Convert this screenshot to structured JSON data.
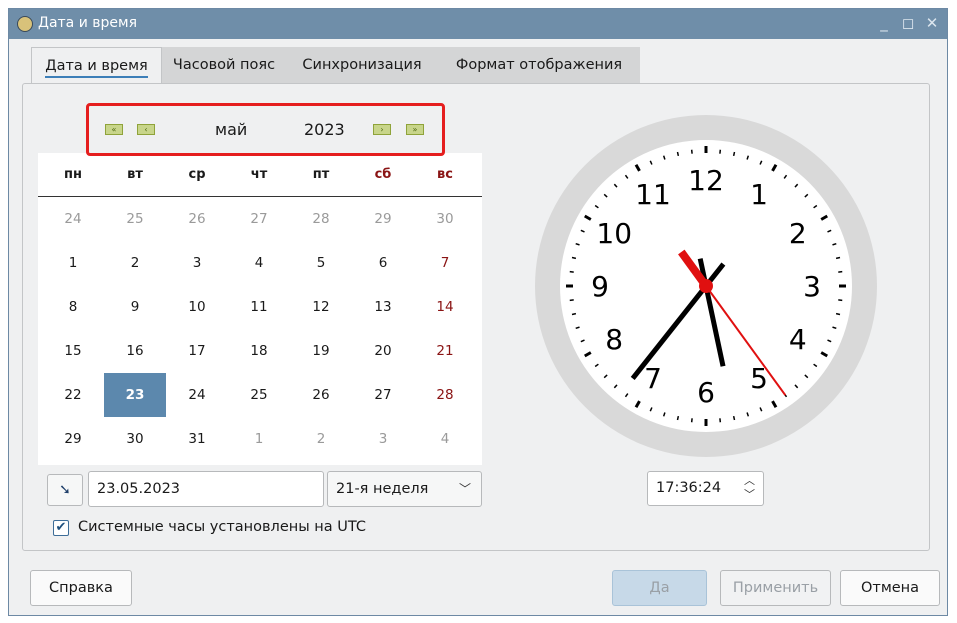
{
  "window": {
    "title": "Дата и время",
    "buttons": {
      "minimize": "_",
      "maximize": "◻",
      "close": "✕"
    }
  },
  "tabs": [
    {
      "label": "Дата и время",
      "active": true
    },
    {
      "label": "Часовой пояс",
      "active": false
    },
    {
      "label": "Синхронизация",
      "active": false
    },
    {
      "label": "Формат отображения",
      "active": false
    }
  ],
  "calendar": {
    "nav": {
      "prev_year": "«",
      "prev_month": "‹",
      "next_month": "›",
      "next_year": "»"
    },
    "month": "май",
    "year": "2023",
    "weekdays": [
      "пн",
      "вт",
      "ср",
      "чт",
      "пт",
      "сб",
      "вс"
    ],
    "weekend_color": "#8a1414",
    "selected_color": "#5c88ad",
    "weeks": [
      [
        "24",
        "25",
        "26",
        "27",
        "28",
        "29",
        "30"
      ],
      [
        "1",
        "2",
        "3",
        "4",
        "5",
        "6",
        "7"
      ],
      [
        "8",
        "9",
        "10",
        "11",
        "12",
        "13",
        "14"
      ],
      [
        "15",
        "16",
        "17",
        "18",
        "19",
        "20",
        "21"
      ],
      [
        "22",
        "23",
        "24",
        "25",
        "26",
        "27",
        "28"
      ],
      [
        "29",
        "30",
        "31",
        "1",
        "2",
        "3",
        "4"
      ]
    ],
    "selected_day": "23"
  },
  "date_field": {
    "value": "23.05.2023"
  },
  "week_select": {
    "value": "21-я неделя"
  },
  "utc_checkbox": {
    "checked": true,
    "label": "Системные часы установлены на UTC"
  },
  "clock": {
    "numbers": [
      "12",
      "1",
      "2",
      "3",
      "4",
      "5",
      "6",
      "7",
      "8",
      "9",
      "10",
      "11"
    ],
    "time": {
      "hours": 17,
      "minutes": 36,
      "seconds": 24
    }
  },
  "time_field": {
    "value": "17:36:24"
  },
  "buttons": {
    "help": "Справка",
    "ok": "Да",
    "apply": "Применить",
    "cancel": "Отмена"
  }
}
